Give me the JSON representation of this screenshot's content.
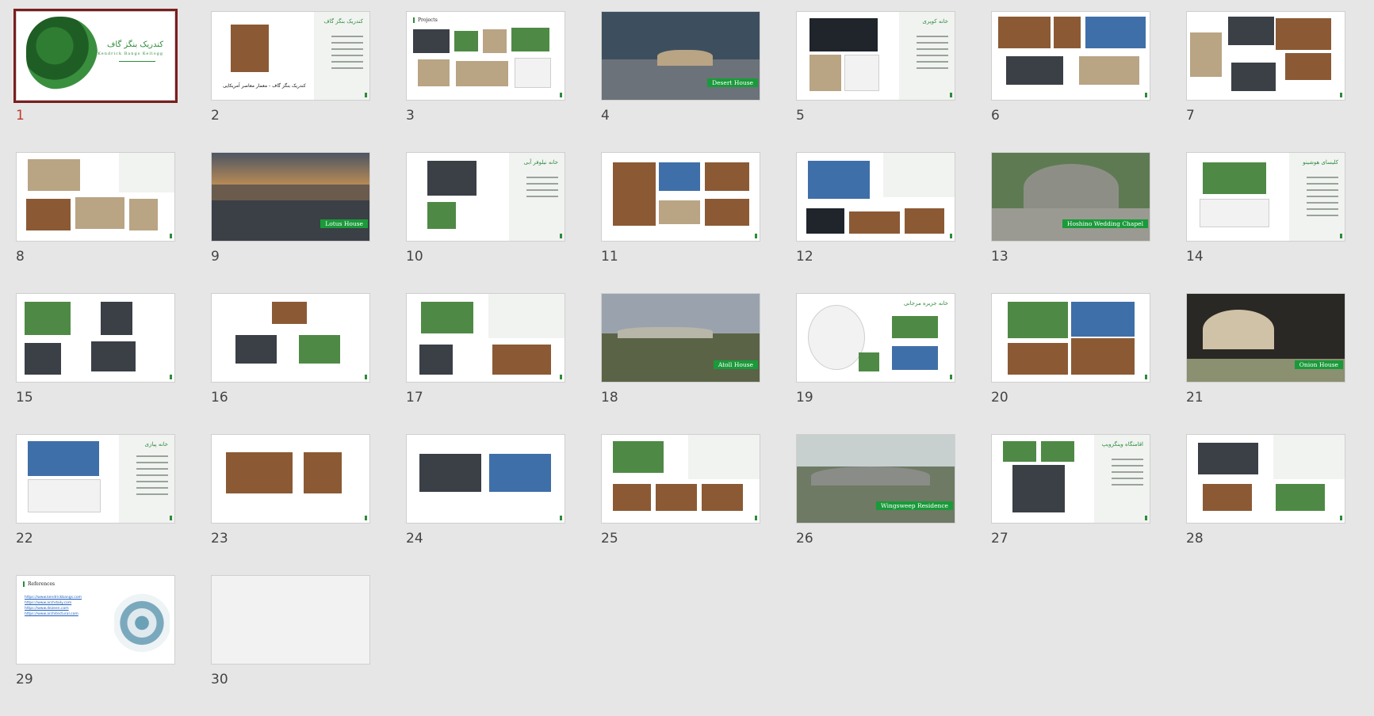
{
  "colors": {
    "accent": "#2e8b3a",
    "selection": "#7b1e1e",
    "badge": "#1a9a3a"
  },
  "slides": [
    {
      "number": "1",
      "selected": true,
      "title": "کندریک بنگز گاف",
      "subtitle": "Kendrick Bangs Kellogg",
      "icon": "tree-graphic"
    },
    {
      "number": "2",
      "title": "کندریک بنگز گاف",
      "caption": "کندریک بنگز گاف - معمار معاصر آمریکایی"
    },
    {
      "number": "3",
      "title": "Projects"
    },
    {
      "number": "4",
      "badge": "Desert House"
    },
    {
      "number": "5",
      "title": "خانه کویری"
    },
    {
      "number": "6"
    },
    {
      "number": "7"
    },
    {
      "number": "8"
    },
    {
      "number": "9",
      "badge": "Lotus House"
    },
    {
      "number": "10",
      "title": "خانه نیلوفر آبی"
    },
    {
      "number": "11"
    },
    {
      "number": "12"
    },
    {
      "number": "13",
      "badge": "Hoshino Wedding Chapel"
    },
    {
      "number": "14",
      "title": "کلیسای هوشینو"
    },
    {
      "number": "15"
    },
    {
      "number": "16"
    },
    {
      "number": "17"
    },
    {
      "number": "18",
      "badge": "Atoll House"
    },
    {
      "number": "19",
      "title": "خانه جزیره مرجانی"
    },
    {
      "number": "20"
    },
    {
      "number": "21",
      "badge": "Onion House"
    },
    {
      "number": "22",
      "title": "خانه پیازی"
    },
    {
      "number": "23"
    },
    {
      "number": "24"
    },
    {
      "number": "25"
    },
    {
      "number": "26",
      "badge": "Wingsweep Residence"
    },
    {
      "number": "27",
      "title": "اقامتگاه وینگزویپ"
    },
    {
      "number": "28"
    },
    {
      "number": "29",
      "title": "References",
      "links": [
        "https://www.kendrickbangs.com",
        "https://www.archdaily.com",
        "https://www.dezeen.com",
        "https://www.architectural.com"
      ]
    },
    {
      "number": "30"
    }
  ]
}
